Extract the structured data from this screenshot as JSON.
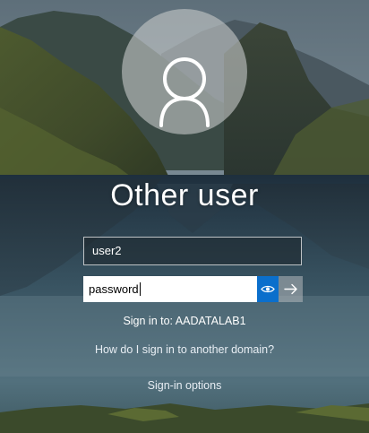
{
  "user": {
    "display_name": "Other user",
    "avatar_icon": "person-outline-icon"
  },
  "form": {
    "username_value": "user2",
    "password_value": "password",
    "reveal_icon": "eye-icon",
    "submit_icon": "arrow-right-icon"
  },
  "domain": {
    "sign_in_to_label": "Sign in to: AADATALAB1"
  },
  "links": {
    "other_domain": "How do I sign in to another domain?",
    "sign_in_options": "Sign-in options"
  },
  "colors": {
    "accent": "#0b6fcc",
    "text": "#ffffff"
  }
}
